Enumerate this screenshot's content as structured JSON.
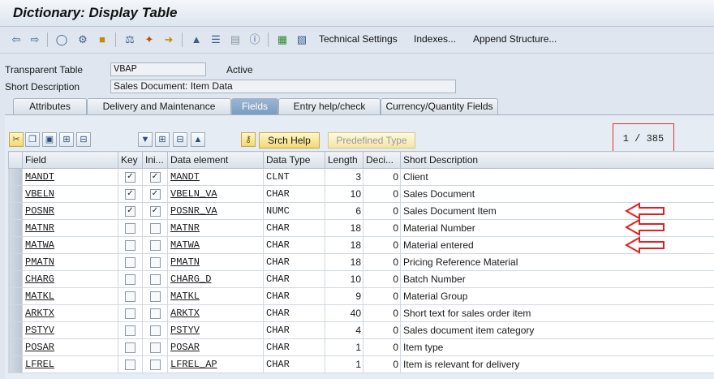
{
  "window": {
    "title": "Dictionary: Display Table"
  },
  "toolbar": {
    "technical_settings": "Technical Settings",
    "indexes": "Indexes...",
    "append_structure": "Append Structure..."
  },
  "header": {
    "transparent_table_label": "Transparent Table",
    "table_name": "VBAP",
    "status": "Active",
    "short_description_label": "Short Description",
    "short_description": "Sales Document: Item Data"
  },
  "tabs": [
    {
      "label": "Attributes"
    },
    {
      "label": "Delivery and Maintenance"
    },
    {
      "label": "Fields"
    },
    {
      "label": "Entry help/check"
    },
    {
      "label": "Currency/Quantity Fields"
    }
  ],
  "buttons": {
    "srch_help": "Srch Help",
    "predefined_type": "Predefined Type"
  },
  "pager": {
    "text": "1 / 385"
  },
  "table": {
    "columns": [
      "Field",
      "Key",
      "Ini...",
      "Data element",
      "Data Type",
      "Length",
      "Deci...",
      "Short Description"
    ],
    "rows": [
      {
        "field": "MANDT",
        "key": true,
        "ini": true,
        "element": "MANDT",
        "type": "CLNT",
        "length": "3",
        "dec": "0",
        "desc": "Client"
      },
      {
        "field": "VBELN",
        "key": true,
        "ini": true,
        "element": "VBELN_VA",
        "type": "CHAR",
        "length": "10",
        "dec": "0",
        "desc": "Sales Document"
      },
      {
        "field": "POSNR",
        "key": true,
        "ini": true,
        "element": "POSNR_VA",
        "type": "NUMC",
        "length": "6",
        "dec": "0",
        "desc": "Sales Document Item"
      },
      {
        "field": "MATNR",
        "key": false,
        "ini": false,
        "element": "MATNR",
        "type": "CHAR",
        "length": "18",
        "dec": "0",
        "desc": "Material Number"
      },
      {
        "field": "MATWA",
        "key": false,
        "ini": false,
        "element": "MATWA",
        "type": "CHAR",
        "length": "18",
        "dec": "0",
        "desc": "Material entered"
      },
      {
        "field": "PMATN",
        "key": false,
        "ini": false,
        "element": "PMATN",
        "type": "CHAR",
        "length": "18",
        "dec": "0",
        "desc": "Pricing Reference Material"
      },
      {
        "field": "CHARG",
        "key": false,
        "ini": false,
        "element": "CHARG_D",
        "type": "CHAR",
        "length": "10",
        "dec": "0",
        "desc": "Batch Number"
      },
      {
        "field": "MATKL",
        "key": false,
        "ini": false,
        "element": "MATKL",
        "type": "CHAR",
        "length": "9",
        "dec": "0",
        "desc": "Material Group"
      },
      {
        "field": "ARKTX",
        "key": false,
        "ini": false,
        "element": "ARKTX",
        "type": "CHAR",
        "length": "40",
        "dec": "0",
        "desc": "Short text for sales order item"
      },
      {
        "field": "PSTYV",
        "key": false,
        "ini": false,
        "element": "PSTYV",
        "type": "CHAR",
        "length": "4",
        "dec": "0",
        "desc": "Sales document item category"
      },
      {
        "field": "POSAR",
        "key": false,
        "ini": false,
        "element": "POSAR",
        "type": "CHAR",
        "length": "1",
        "dec": "0",
        "desc": "Item type"
      },
      {
        "field": "LFREL",
        "key": false,
        "ini": false,
        "element": "LFREL_AP",
        "type": "CHAR",
        "length": "1",
        "dec": "0",
        "desc": "Item is relevant for delivery"
      }
    ]
  },
  "colors": {
    "annotation_red": "#e02020",
    "active_tab": "#7b9cc0"
  }
}
